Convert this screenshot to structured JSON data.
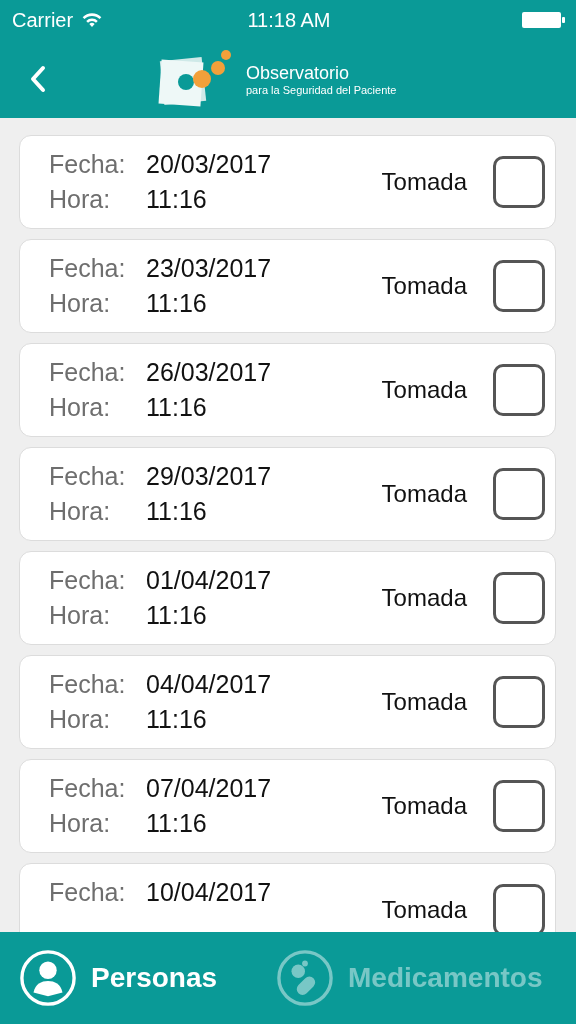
{
  "status_bar": {
    "carrier": "Carrier",
    "time": "11:18 AM"
  },
  "nav_bar": {
    "title": "Observatorio",
    "subtitle": "para la Seguridad del Paciente"
  },
  "doses": [
    {
      "date_label": "Fecha:",
      "date": "20/03/2017",
      "time_label": "Hora:",
      "time": "11:16",
      "status_label": "Tomada",
      "checked": false
    },
    {
      "date_label": "Fecha:",
      "date": "23/03/2017",
      "time_label": "Hora:",
      "time": "11:16",
      "status_label": "Tomada",
      "checked": false
    },
    {
      "date_label": "Fecha:",
      "date": "26/03/2017",
      "time_label": "Hora:",
      "time": "11:16",
      "status_label": "Tomada",
      "checked": false
    },
    {
      "date_label": "Fecha:",
      "date": "29/03/2017",
      "time_label": "Hora:",
      "time": "11:16",
      "status_label": "Tomada",
      "checked": false
    },
    {
      "date_label": "Fecha:",
      "date": "01/04/2017",
      "time_label": "Hora:",
      "time": "11:16",
      "status_label": "Tomada",
      "checked": false
    },
    {
      "date_label": "Fecha:",
      "date": "04/04/2017",
      "time_label": "Hora:",
      "time": "11:16",
      "status_label": "Tomada",
      "checked": false
    },
    {
      "date_label": "Fecha:",
      "date": "07/04/2017",
      "time_label": "Hora:",
      "time": "11:16",
      "status_label": "Tomada",
      "checked": false
    },
    {
      "date_label": "Fecha:",
      "date": "10/04/2017",
      "status_label": "Tomada",
      "checked": false
    }
  ],
  "tabs": [
    {
      "label": "Personas",
      "kind": "person",
      "selected": true
    },
    {
      "label": "Medicamentos",
      "kind": "pills",
      "selected": false
    }
  ]
}
